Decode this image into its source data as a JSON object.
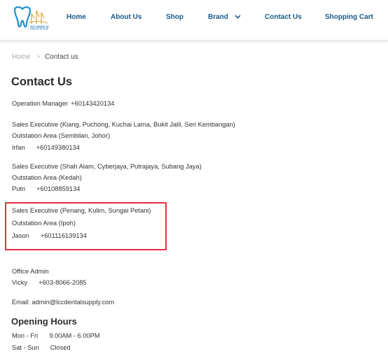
{
  "header": {
    "logo_text": "SUPPLY",
    "nav": [
      {
        "label": "Home"
      },
      {
        "label": "About Us"
      },
      {
        "label": "Shop"
      },
      {
        "label": "Brand"
      },
      {
        "label": "Contact Us"
      },
      {
        "label": "Shopping Cart"
      }
    ]
  },
  "breadcrumb": {
    "home": "Home",
    "separator": ">",
    "current": "Contact us"
  },
  "page": {
    "title": "Contact Us",
    "operation": {
      "role": "Operation Manager",
      "phone": "+60143420134"
    },
    "contacts": [
      {
        "role": "Sales Executive (Klang, Puchong, Kuchai Lama, Bukit Jalil, Seri Kembangan)",
        "area": "Outstation Area (Sembilan, Johor)",
        "name": "Irfan",
        "phone": "+60149380134"
      },
      {
        "role": "Sales Executive (Shah Alam, Cyberjaya, Putrajaya, Subang Jaya)",
        "area": "Outstation Area (Kedah)",
        "name": "Putri",
        "phone": "+60108859134"
      },
      {
        "role": "Sales Executive (Penang, Kulim, Sungai Petani)",
        "area": "Outstation Area (Ipoh)",
        "name": "Jason",
        "phone": "+601116139134"
      }
    ],
    "office": {
      "role": "Office Admin",
      "name": "Vicky",
      "phone": "+603-8066-2085"
    },
    "email": "Email: admin@lccdentalsupply.com",
    "hours_title": "Opening Hours",
    "hours": [
      {
        "days": "Mon - Fri",
        "time": "9.00AM - 6.00PM"
      },
      {
        "days": "Sat - Sun",
        "time": "Closed"
      }
    ]
  },
  "colors": {
    "nav": "#1a5a8a",
    "highlight": "#e5303a",
    "text": "#333333"
  }
}
